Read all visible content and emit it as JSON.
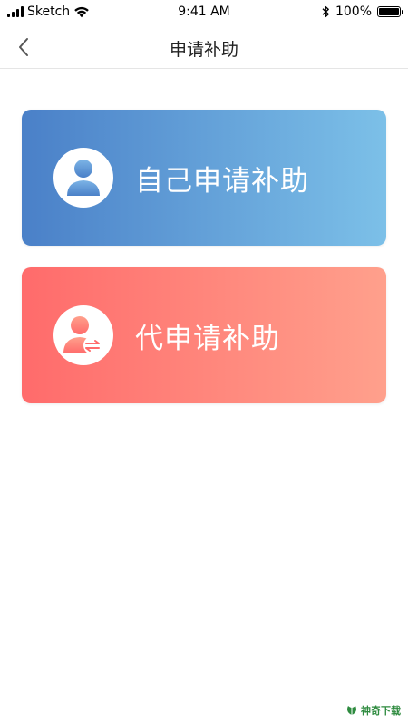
{
  "status_bar": {
    "carrier": "Sketch",
    "time": "9:41 AM",
    "battery_percent": 100,
    "battery_text": "100%",
    "icons": [
      "signal-icon",
      "wifi-icon",
      "bluetooth-icon",
      "battery-icon"
    ]
  },
  "nav": {
    "title": "申请补助",
    "back_icon": "chevron-left-icon"
  },
  "options": {
    "self": {
      "label": "自己申请补助",
      "icon": "user-icon",
      "color_start": "#4a80c8",
      "color_end": "#7cc0e8"
    },
    "other": {
      "label": "代申请补助",
      "icon": "user-transfer-icon",
      "color_start": "#ff6b6b",
      "color_end": "#ffa08c"
    }
  },
  "watermark": {
    "text": "神奇下载"
  }
}
